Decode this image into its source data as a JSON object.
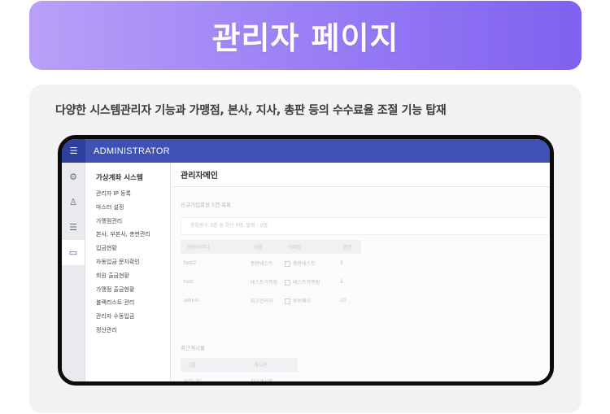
{
  "banner": {
    "title": "관리자 페이지"
  },
  "description": "다양한 시스템관리자 기능과 가맹점, 본사, 지사, 총판 등의 수수료율 조절 기능 탑재",
  "app": {
    "header": {
      "menu_icon": "menu-collapse-icon",
      "title": "ADMINISTRATOR",
      "bar_color": "#3f51b5"
    },
    "icon_rail": [
      {
        "icon": "gear-icon",
        "glyph": "⚙",
        "active": false
      },
      {
        "icon": "user-icon",
        "glyph": "♙",
        "active": false
      },
      {
        "icon": "list-icon",
        "glyph": "☰",
        "active": false
      },
      {
        "icon": "folder-icon",
        "glyph": "▭",
        "active": true
      }
    ],
    "sidebar": {
      "title": "가상계좌 시스템",
      "items": [
        "관리자 IP 등록",
        "마스터 설정",
        "가맹점관리",
        "본사, 부본사, 총판관리",
        "입금현황",
        "자동입금 문자확인",
        "회원 출금현황",
        "가맹점 출금현황",
        "블랙리스트 관리",
        "관리자 수동입금",
        "정산관리"
      ]
    },
    "main": {
      "title": "관리자메인",
      "new_members": {
        "title": "신규가입회원 5건 목록",
        "summary": "총회원수 3명 중 차단 0명, 탈퇴 : 0명",
        "columns": [
          "회원아이디",
          "이름",
          "닉네임",
          "권한"
        ],
        "rows": [
          [
            "test2",
            "총판테스트",
            "총판테스트",
            "3"
          ],
          [
            "test",
            "테스트가맹점",
            "테스트가맹점",
            "2"
          ],
          [
            "admin",
            "최고관리자",
            "투브페이",
            "10"
          ]
        ]
      },
      "recent_posts": {
        "title": "최근게시물",
        "columns": [
          "그룹",
          "게시판"
        ],
        "rows": [
          [
            "커뮤니티",
            "자유게시판"
          ]
        ]
      }
    }
  }
}
